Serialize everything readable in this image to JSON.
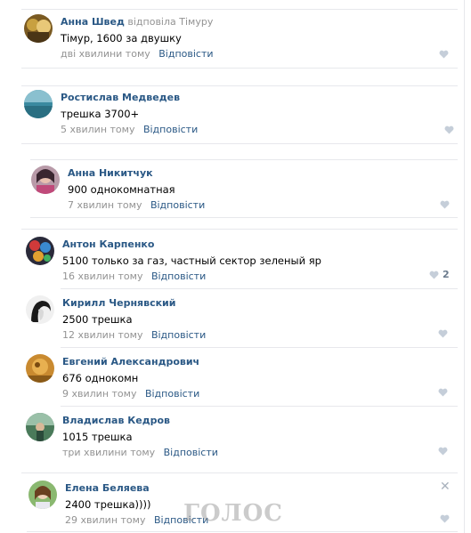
{
  "comments": [
    {
      "author": "Анна Швед",
      "reply_word": "відповіла",
      "reply_target": "Тімуру",
      "text": "Тімур, 1600 за двушку",
      "time": "дві хвилини тому",
      "reply_label": "Відповісти",
      "likes": ""
    },
    {
      "author": "Ростислав Медведев",
      "text": "трешка 3700+",
      "time": "5 хвилин тому",
      "reply_label": "Відповісти",
      "likes": ""
    },
    {
      "author": "Анна Никитчук",
      "text": "900 однокомнатная",
      "time": "7 хвилин тому",
      "reply_label": "Відповісти",
      "likes": ""
    },
    {
      "author": "Антон Карпенко",
      "text": "5100 только за газ, частный сектор зеленый яр",
      "time": "16 хвилин тому",
      "reply_label": "Відповісти",
      "likes": "2"
    },
    {
      "author": "Кирилл Чернявский",
      "text": "2500 трешка",
      "time": "12 хвилин тому",
      "reply_label": "Відповісти",
      "likes": ""
    },
    {
      "author": "Евгений Александрович",
      "text": "676 однокомн",
      "time": "9 хвилин тому",
      "reply_label": "Відповісти",
      "likes": ""
    },
    {
      "author": "Владислав Кедров",
      "text": "1015 трешка",
      "time": "три хвилини тому",
      "reply_label": "Відповісти",
      "likes": ""
    },
    {
      "author": "Елена Беляева",
      "text": "2400 трешка))))",
      "time": "29 хвилин тому",
      "reply_label": "Відповісти",
      "likes": ""
    }
  ],
  "watermark": "ГОЛОС",
  "icons": {
    "like": "heart-icon",
    "close": "close-icon"
  },
  "colors": {
    "link": "#2a5885",
    "muted": "#939393",
    "like": "#8a9bb0"
  }
}
